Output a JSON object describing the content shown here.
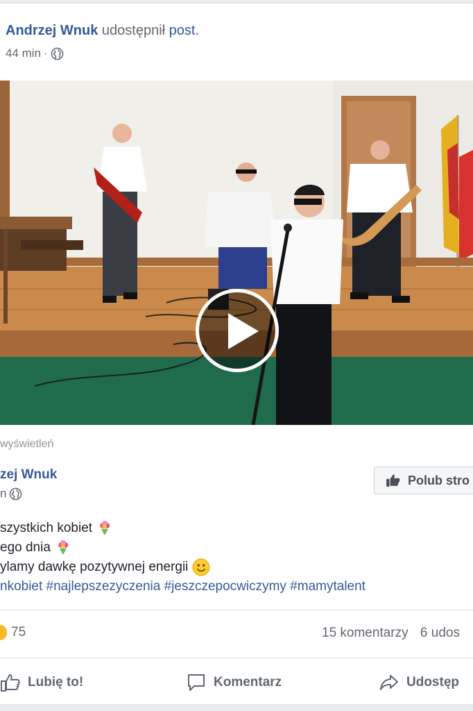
{
  "header": {
    "sharer_name": "Andrzej Wnuk",
    "action_text": "udostępnił",
    "post_link": "post.",
    "time": "44 min",
    "separator": "·"
  },
  "video": {
    "play_icon": "play-icon"
  },
  "views_text": "wyświetleń",
  "original_post": {
    "page_name": "zej Wnuk",
    "time": "n",
    "like_page_label": "Polub stro",
    "lines": [
      "szystkich kobiet",
      "ego dnia",
      "ylamy dawkę pozytywnej energii",
      "nkobiet #najlepszezyczenia #jeszczepocwiczymy #mamytalent"
    ]
  },
  "reactions": {
    "count": "75",
    "comments": "15 komentarzy",
    "shares": "6 udos"
  },
  "actions": {
    "like": "Lubię to!",
    "comment": "Komentarz",
    "share": "Udostęp"
  },
  "colors": {
    "link": "#365899",
    "secondary": "#616770",
    "stage_floor": "#c98a4b",
    "carpet": "#1f6b4c"
  }
}
